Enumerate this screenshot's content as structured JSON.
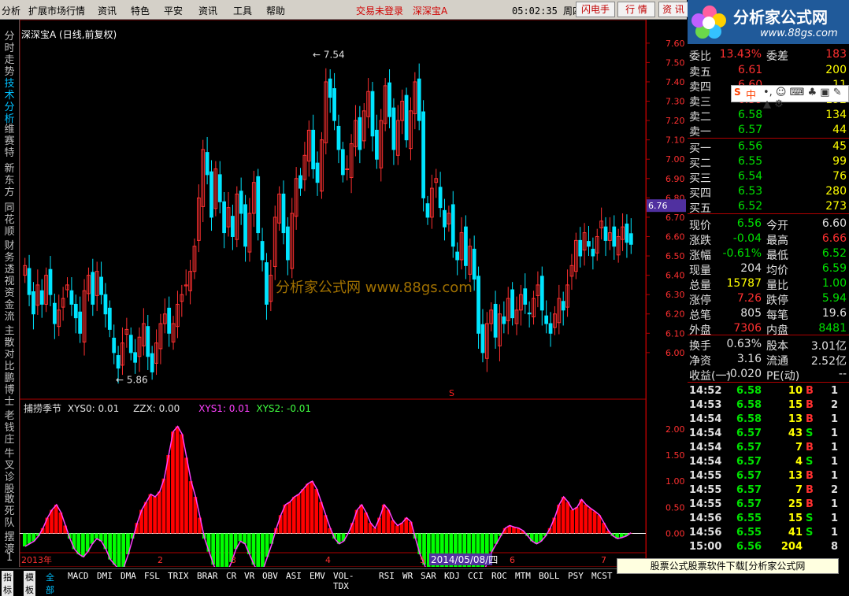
{
  "menu": {
    "items": [
      "分析",
      "扩展市场行情",
      "资讯",
      "特色",
      "平安",
      "资讯",
      "工具",
      "帮助"
    ],
    "status_left": "交易未登录",
    "stock_name": "深深宝A",
    "time": "05:02:35 周四",
    "btn_flash": "闪电手",
    "btn_quote": "行 情",
    "btn_info": "资 讯"
  },
  "logo": {
    "title": "分析家公式网",
    "url": "www.88gs.com"
  },
  "sidebar": {
    "tabs": [
      "分时走势",
      "技术分析",
      "维赛特",
      "新东方",
      "同花顺",
      "财务透视",
      "资金流",
      "主散对比",
      "鹏博士",
      "老钱庄",
      "牛叉诊股",
      "敢死队",
      "摆渡"
    ],
    "footer": "1"
  },
  "chart_main": {
    "title": "深深宝A (日线,前复权)",
    "high_label": "7.54",
    "low_label": "5.86",
    "watermark": "分析家公式网 www.88gs.com",
    "cur_price": "6.76",
    "marker": "S"
  },
  "chart_sub": {
    "name": "捕捞季节",
    "xys0": "XYS0: 0.01",
    "zzx": "ZZX: 0.00",
    "xys1": "XYS1: 0.01",
    "xys2": "XYS2: -0.01"
  },
  "chart_data": [
    {
      "type": "candlestick",
      "yticks": [
        "7.60",
        "7.50",
        "7.40",
        "7.30",
        "7.20",
        "7.10",
        "7.00",
        "6.90",
        "6.80",
        "6.70",
        "6.60",
        "6.50",
        "6.40",
        "6.30",
        "6.20",
        "6.10",
        "6.00"
      ],
      "ylim": [
        5.8,
        7.64
      ],
      "close": [
        6.45,
        6.3,
        6.2,
        6.35,
        6.25,
        6.4,
        6.3,
        6.15,
        6.22,
        6.28,
        6.35,
        6.25,
        6.18,
        6.1,
        6.32,
        6.4,
        6.25,
        6.42,
        6.3,
        6.2,
        6.12,
        6.0,
        5.92,
        6.05,
        6.12,
        6.0,
        5.95,
        6.08,
        6.15,
        5.98,
        5.9,
        6.05,
        6.15,
        6.2,
        6.1,
        6.15,
        6.25,
        6.3,
        6.35,
        6.42,
        6.55,
        6.8,
        7.05,
        6.92,
        6.7,
        6.95,
        6.78,
        6.62,
        6.75,
        6.6,
        6.82,
        6.72,
        6.55,
        6.72,
        6.88,
        6.62,
        6.48,
        6.25,
        6.4,
        6.7,
        6.82,
        6.62,
        6.48,
        6.72,
        6.9,
        6.85,
        7.02,
        7.15,
        6.95,
        6.88,
        7.1,
        7.4,
        7.32,
        7.2,
        7.05,
        6.92,
        6.95,
        7.08,
        7.2,
        7.05,
        7.25,
        7.35,
        7.12,
        7.0,
        7.2,
        7.38,
        7.22,
        7.05,
        7.2,
        7.3,
        7.1,
        7.25,
        7.4,
        7.2,
        6.8,
        6.7,
        6.85,
        6.9,
        6.75,
        6.65,
        6.72,
        6.55,
        6.48,
        6.62,
        6.45,
        6.55,
        6.38,
        6.1,
        6.0,
        6.15,
        6.22,
        6.08,
        6.2,
        6.15,
        6.28,
        6.18,
        6.22,
        6.3,
        6.25,
        6.2,
        6.28,
        6.35,
        6.22,
        6.15,
        6.1,
        6.2,
        6.28,
        6.22,
        6.35,
        6.45,
        6.58,
        6.5,
        6.62,
        6.55,
        6.5,
        6.6,
        6.68,
        6.58,
        6.62,
        6.55,
        6.6,
        6.65,
        6.57,
        6.56
      ],
      "high_label": 7.54,
      "low_label": 5.86
    },
    {
      "type": "bar",
      "ylim": [
        -0.28,
        2.3
      ],
      "yticks": [
        "2.00",
        "1.50",
        "1.00",
        "0.50",
        "0.00"
      ],
      "values": [
        -0.25,
        -0.2,
        -0.15,
        -0.05,
        0.1,
        0.3,
        0.45,
        0.55,
        0.4,
        0.15,
        -0.1,
        -0.3,
        -0.4,
        -0.45,
        -0.35,
        -0.2,
        -0.1,
        -0.15,
        -0.3,
        -0.5,
        -0.6,
        -0.7,
        -0.65,
        -0.4,
        -0.1,
        0.2,
        0.45,
        0.6,
        0.75,
        0.7,
        0.8,
        1.05,
        1.5,
        1.95,
        2.05,
        1.9,
        1.45,
        1.0,
        0.7,
        0.3,
        -0.1,
        -0.35,
        -0.6,
        -0.8,
        -0.85,
        -0.75,
        -0.55,
        -0.3,
        -0.15,
        -0.2,
        -0.4,
        -0.6,
        -0.75,
        -0.7,
        -0.45,
        -0.2,
        0.1,
        0.35,
        0.55,
        0.6,
        0.7,
        0.75,
        0.85,
        0.95,
        1.0,
        0.85,
        0.6,
        0.35,
        0.1,
        -0.1,
        -0.2,
        -0.15,
        0.0,
        0.2,
        0.45,
        0.55,
        0.4,
        0.2,
        0.1,
        0.3,
        0.55,
        0.45,
        0.25,
        0.15,
        0.2,
        0.3,
        0.22,
        -0.1,
        -0.4,
        -0.6,
        -0.85,
        -1.05,
        -1.1,
        -1.0,
        -0.85,
        -0.95,
        -1.1,
        -1.3,
        -1.5,
        -1.55,
        -1.35,
        -1.05,
        -0.8,
        -0.55,
        -0.35,
        -0.2,
        -0.05,
        0.1,
        0.15,
        0.12,
        0.1,
        0.05,
        -0.05,
        -0.15,
        -0.2,
        -0.15,
        -0.05,
        0.1,
        0.3,
        0.55,
        0.7,
        0.6,
        0.45,
        0.5,
        0.65,
        0.55,
        0.48,
        0.42,
        0.35,
        0.2,
        0.05,
        -0.05,
        -0.1,
        -0.08,
        -0.05,
        0.01
      ]
    }
  ],
  "axis_dates": [
    "2013年",
    "2",
    "3",
    "4",
    "5",
    "2014/05/08/四",
    "6",
    "7"
  ],
  "quote": {
    "weibi_label": "委比",
    "weibi": "13.43%",
    "weicha_label": "委差",
    "weicha": "183",
    "sell": [
      {
        "label": "卖五",
        "price": "6.61",
        "vol": "200",
        "color": "red"
      },
      {
        "label": "卖四",
        "price": "6.60",
        "vol": "11",
        "color": "red"
      },
      {
        "label": "卖三",
        "price": "6.59",
        "vol": "192",
        "color": "red"
      },
      {
        "label": "卖二",
        "price": "6.58",
        "vol": "134",
        "color": "green"
      },
      {
        "label": "卖一",
        "price": "6.57",
        "vol": "44",
        "color": "green"
      }
    ],
    "buy": [
      {
        "label": "买一",
        "price": "6.56",
        "vol": "45",
        "color": "green"
      },
      {
        "label": "买二",
        "price": "6.55",
        "vol": "99",
        "color": "green"
      },
      {
        "label": "买三",
        "price": "6.54",
        "vol": "76",
        "color": "green"
      },
      {
        "label": "买四",
        "price": "6.53",
        "vol": "280",
        "color": "green"
      },
      {
        "label": "买五",
        "price": "6.52",
        "vol": "273",
        "color": "green"
      }
    ],
    "stats": [
      {
        "l1": "现价",
        "v1": "6.56",
        "c1": "green",
        "l2": "今开",
        "v2": "6.60",
        "c2": "white"
      },
      {
        "l1": "涨跌",
        "v1": "-0.04",
        "c1": "green",
        "l2": "最高",
        "v2": "6.66",
        "c2": "red"
      },
      {
        "l1": "涨幅",
        "v1": "-0.61%",
        "c1": "green",
        "l2": "最低",
        "v2": "6.52",
        "c2": "green"
      },
      {
        "l1": "现量",
        "v1": "204",
        "c1": "white",
        "l2": "均价",
        "v2": "6.59",
        "c2": "green"
      },
      {
        "l1": "总量",
        "v1": "15787",
        "c1": "yellow",
        "l2": "量比",
        "v2": "1.00",
        "c2": "green"
      },
      {
        "l1": "涨停",
        "v1": "7.26",
        "c1": "red",
        "l2": "跌停",
        "v2": "5.94",
        "c2": "green"
      },
      {
        "l1": "总笔",
        "v1": "805",
        "c1": "white",
        "l2": "每笔",
        "v2": "19.6",
        "c2": "white"
      },
      {
        "l1": "外盘",
        "v1": "7306",
        "c1": "red",
        "l2": "内盘",
        "v2": "8481",
        "c2": "green"
      }
    ],
    "stats2": [
      {
        "l1": "换手",
        "v1": "0.63%",
        "c1": "white",
        "l2": "股本",
        "v2": "3.01亿",
        "c2": "white"
      },
      {
        "l1": "净资",
        "v1": "3.16",
        "c1": "white",
        "l2": "流通",
        "v2": "2.52亿",
        "c2": "white"
      },
      {
        "l1": "收益(一)",
        "v1": "-0.020",
        "c1": "white",
        "l2": "PE(动)",
        "v2": "--",
        "c2": "white"
      }
    ]
  },
  "ticks": [
    {
      "time": "14:52",
      "price": "6.58",
      "vol": "10",
      "bs": "B",
      "n": "1"
    },
    {
      "time": "14:53",
      "price": "6.58",
      "vol": "15",
      "bs": "B",
      "n": "2"
    },
    {
      "time": "14:54",
      "price": "6.58",
      "vol": "13",
      "bs": "B",
      "n": "1"
    },
    {
      "time": "14:54",
      "price": "6.57",
      "vol": "43",
      "bs": "S",
      "n": "1"
    },
    {
      "time": "14:54",
      "price": "6.57",
      "vol": "7",
      "bs": "B",
      "n": "1"
    },
    {
      "time": "14:54",
      "price": "6.57",
      "vol": "4",
      "bs": "S",
      "n": "1"
    },
    {
      "time": "14:55",
      "price": "6.57",
      "vol": "13",
      "bs": "B",
      "n": "1"
    },
    {
      "time": "14:55",
      "price": "6.57",
      "vol": "7",
      "bs": "B",
      "n": "2"
    },
    {
      "time": "14:55",
      "price": "6.57",
      "vol": "25",
      "bs": "B",
      "n": "1"
    },
    {
      "time": "14:56",
      "price": "6.55",
      "vol": "15",
      "bs": "S",
      "n": "1"
    },
    {
      "time": "14:56",
      "price": "6.55",
      "vol": "41",
      "bs": "S",
      "n": "1"
    },
    {
      "time": "15:00",
      "price": "6.56",
      "vol": "204",
      "bs": "",
      "n": "8"
    }
  ],
  "bottom_tabs": [
    "指标",
    "模板",
    "全部",
    "MACD",
    "DMI",
    "DMA",
    "FSL",
    "TRIX",
    "BRAR",
    "CR",
    "VR",
    "OBV",
    "ASI",
    "EMV",
    "VOL-TDX",
    "RSI",
    "WR",
    "SAR",
    "KDJ",
    "CCI",
    "ROC",
    "MTM",
    "BOLL",
    "PSY",
    "MCST"
  ],
  "ime": "中",
  "ad": "股票公式股票软件下载[分析家公式网www.88gs.com]",
  "colors": {
    "up": "#ff3030",
    "down": "#00e5ff",
    "pos_bar": "#ff0000",
    "neg_bar": "#00ff00",
    "axis": "#b00000"
  }
}
